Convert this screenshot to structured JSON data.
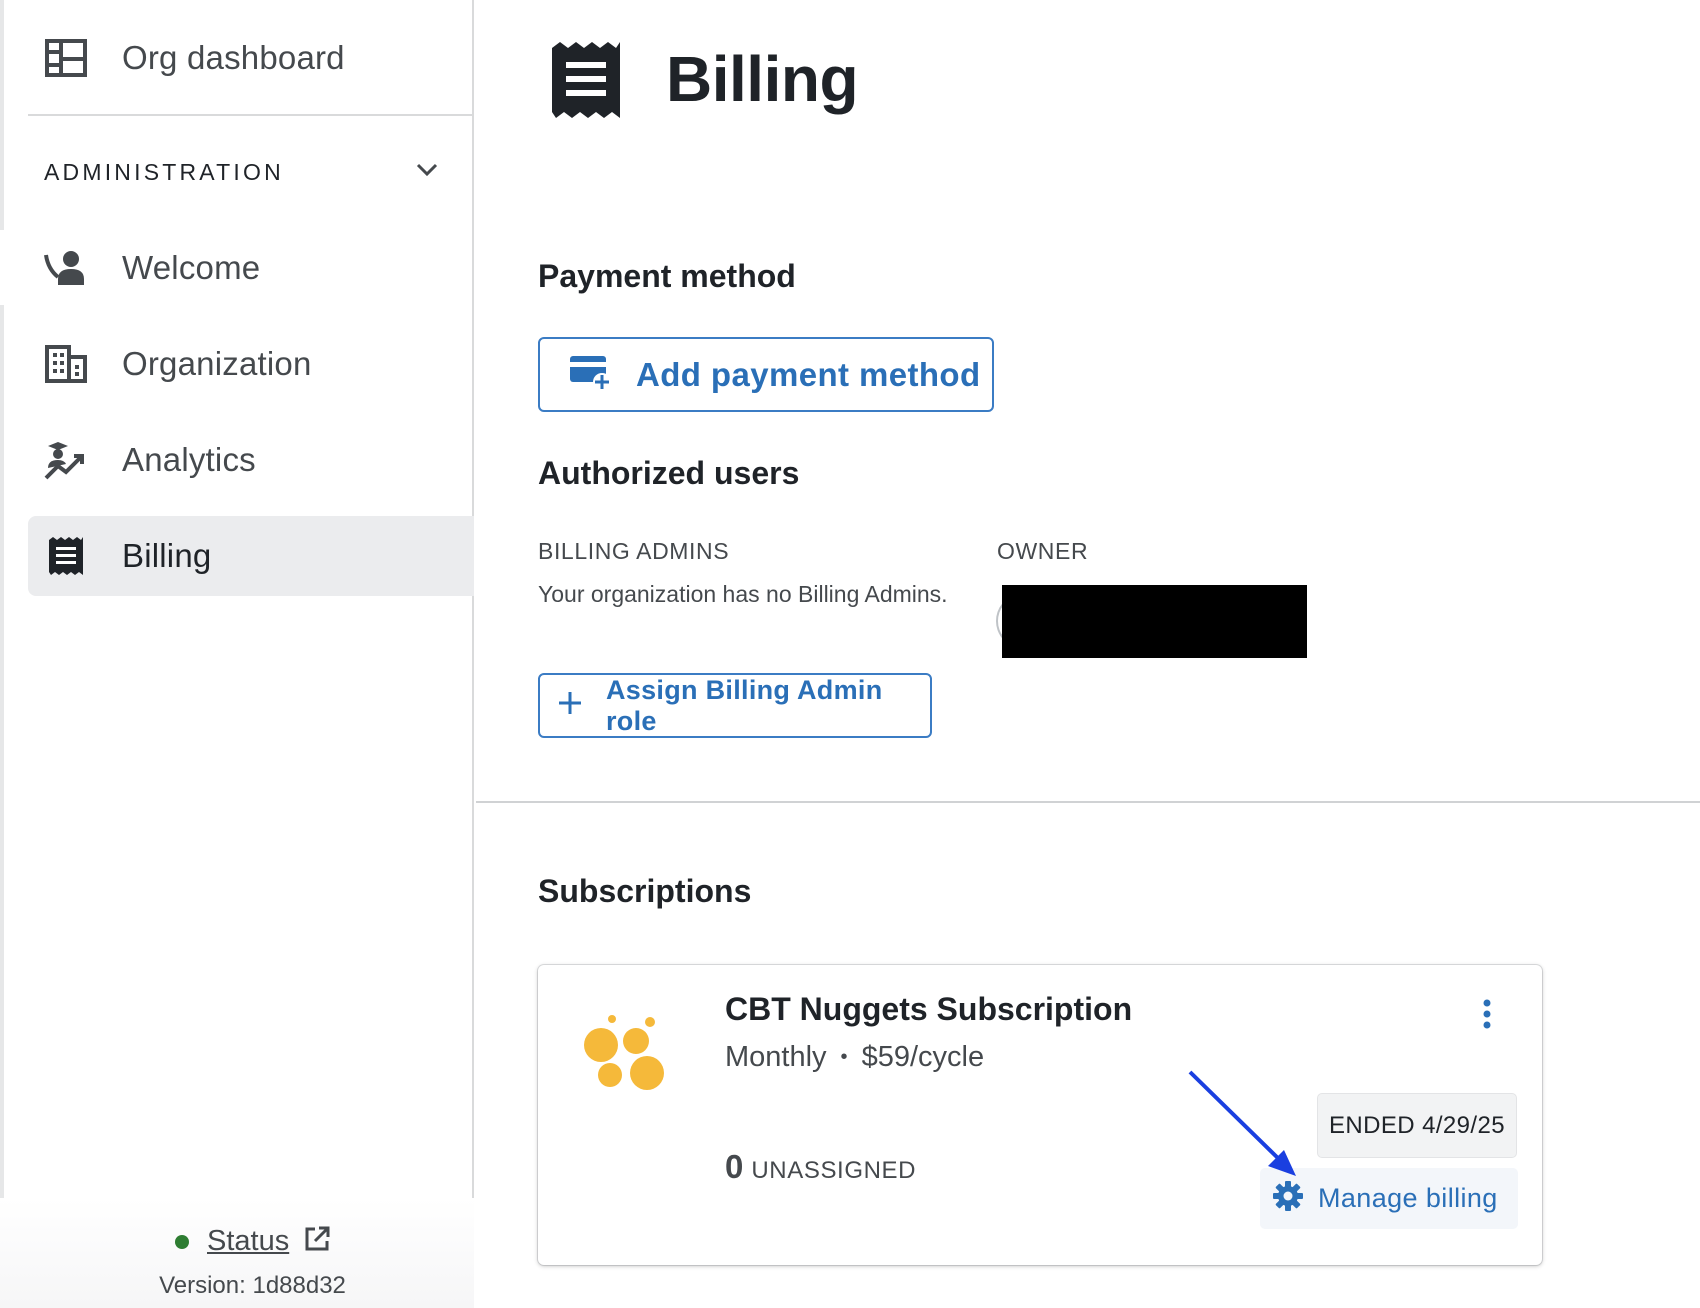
{
  "sidebar": {
    "org_dashboard": "Org dashboard",
    "section_title": "ADMINISTRATION",
    "items": [
      {
        "label": "Welcome",
        "icon": "person-wave-icon"
      },
      {
        "label": "Organization",
        "icon": "building-icon"
      },
      {
        "label": "Analytics",
        "icon": "analytics-icon"
      },
      {
        "label": "Billing",
        "icon": "receipt-icon",
        "active": true
      }
    ],
    "status_label": "Status",
    "status_color": "#2e7d32",
    "version": "Version: 1d88d32"
  },
  "page": {
    "title": "Billing",
    "payment_method": {
      "heading": "Payment method",
      "add_button": "Add payment method"
    },
    "authorized_users": {
      "heading": "Authorized users",
      "billing_admins_label": "BILLING ADMINS",
      "billing_admins_empty": "Your organization has no Billing Admins.",
      "owner_label": "OWNER",
      "assign_button": "Assign Billing Admin role"
    },
    "subscriptions": {
      "heading": "Subscriptions",
      "items": [
        {
          "title": "CBT Nuggets Subscription",
          "cycle": "Monthly",
          "separator": "•",
          "price": "$59/cycle",
          "status": "ENDED 4/29/25",
          "unassigned_count": "0",
          "unassigned_label": "UNASSIGNED",
          "manage_button": "Manage billing"
        }
      ]
    }
  },
  "colors": {
    "accent": "#2a6fb7",
    "logo": "#f5b93a",
    "active_nav_bg": "#ebecee",
    "annotation_arrow": "#1a3fe0"
  }
}
